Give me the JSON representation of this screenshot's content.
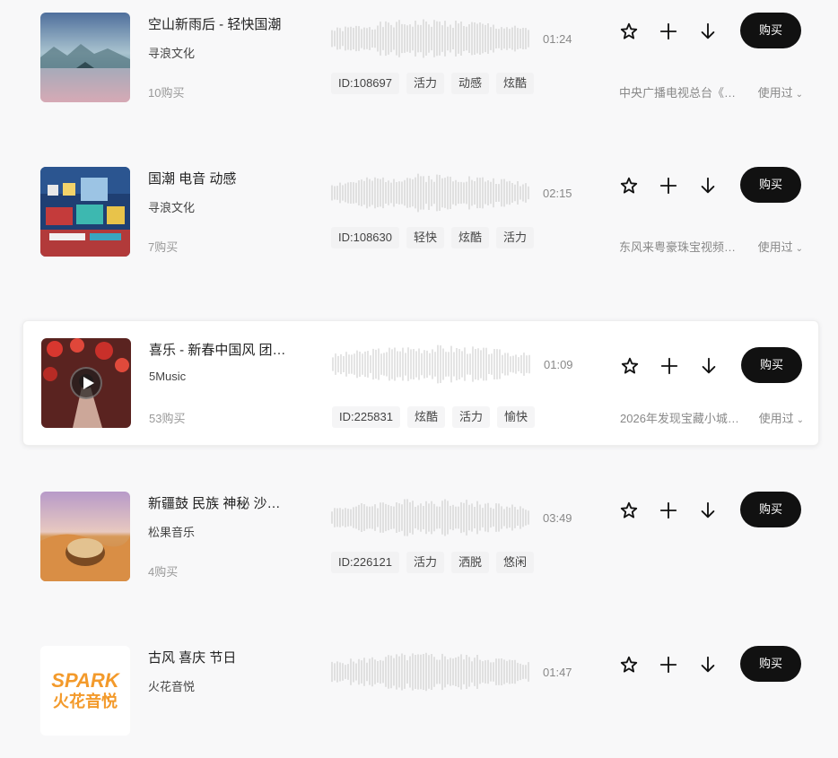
{
  "tracks": [
    {
      "title": "空山新雨后 - 轻快国潮",
      "artist": "寻浪文化",
      "buys": "10购买",
      "duration": "01:24",
      "tags": [
        "ID:108697",
        "活力",
        "动感",
        "炫酷"
      ],
      "usage_project": "中央广播电视总台《…",
      "usage_label": "使用过",
      "buy_label": "购买",
      "cover_icon": "misty-lake-landscape",
      "active": false
    },
    {
      "title": "国潮 电音 动感",
      "artist": "寻浪文化",
      "buys": "7购买",
      "duration": "02:15",
      "tags": [
        "ID:108630",
        "轻快",
        "炫酷",
        "活力"
      ],
      "usage_project": "东风来粤豪珠宝视频…",
      "usage_label": "使用过",
      "buy_label": "购买",
      "cover_icon": "music-studio-illustration",
      "active": false
    },
    {
      "title": "喜乐 - 新春中国风 团…",
      "artist": "5Music",
      "buys": "53购买",
      "duration": "01:09",
      "tags": [
        "ID:225831",
        "炫酷",
        "活力",
        "愉快"
      ],
      "usage_project": "2026年发现宝藏小城…",
      "usage_label": "使用过",
      "buy_label": "购买",
      "cover_icon": "red-lanterns-figure",
      "active": true
    },
    {
      "title": "新疆鼓 民族 神秘 沙…",
      "artist": "松果音乐",
      "buys": "4购买",
      "duration": "03:49",
      "tags": [
        "ID:226121",
        "活力",
        "洒脱",
        "悠闲"
      ],
      "usage_project": "",
      "usage_label": "",
      "buy_label": "购买",
      "cover_icon": "desert-drum",
      "active": false
    },
    {
      "title": "古风 喜庆 节日",
      "artist": "火花音悦",
      "buys": "",
      "duration": "01:47",
      "tags": [],
      "usage_project": "",
      "usage_label": "",
      "buy_label": "购买",
      "cover_icon": "spark-logo",
      "active": false
    }
  ],
  "colors": {
    "background": "#f8f8f9",
    "buy_button": "#111111",
    "waveform": "#c8c8c8",
    "tag_bg": "#f2f2f3"
  }
}
